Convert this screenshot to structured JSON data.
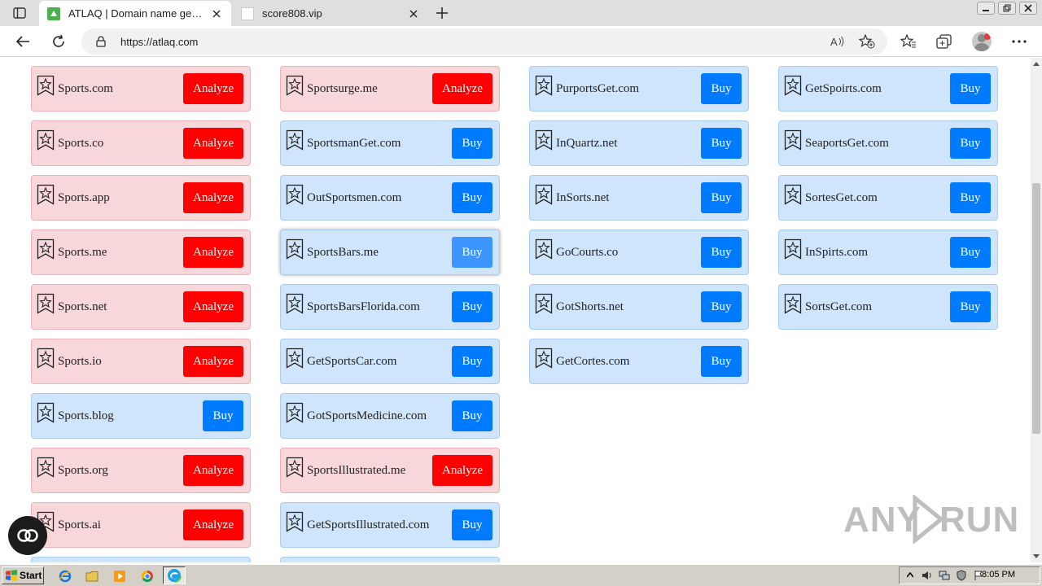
{
  "browser": {
    "tabs": [
      {
        "title": "ATLAQ | Domain name generator",
        "active": true
      },
      {
        "title": "score808.vip",
        "active": false
      }
    ],
    "url": "https://atlaq.com"
  },
  "colors": {
    "taken_bg": "#f8d7da",
    "available_bg": "#cfe5fb",
    "analyze_button": "#ff0000",
    "buy_button": "#007bff"
  },
  "labels": {
    "analyze": "Analyze",
    "buy": "Buy"
  },
  "columns": [
    [
      {
        "name": "Sports.com",
        "status": "taken"
      },
      {
        "name": "Sports.co",
        "status": "taken"
      },
      {
        "name": "Sports.app",
        "status": "taken"
      },
      {
        "name": "Sports.me",
        "status": "taken"
      },
      {
        "name": "Sports.net",
        "status": "taken"
      },
      {
        "name": "Sports.io",
        "status": "taken"
      },
      {
        "name": "Sports.blog",
        "status": "available"
      },
      {
        "name": "Sports.org",
        "status": "taken"
      },
      {
        "name": "Sports.ai",
        "status": "taken"
      }
    ],
    [
      {
        "name": "Sportsurge.me",
        "status": "taken"
      },
      {
        "name": "SportsmanGet.com",
        "status": "available"
      },
      {
        "name": "OutSportsmen.com",
        "status": "available"
      },
      {
        "name": "SportsBars.me",
        "status": "available",
        "hover": true
      },
      {
        "name": "SportsBarsFlorida.com",
        "status": "available"
      },
      {
        "name": "GetSportsCar.com",
        "status": "available"
      },
      {
        "name": "GotSportsMedicine.com",
        "status": "available"
      },
      {
        "name": "SportsIllustrated.me",
        "status": "taken"
      },
      {
        "name": "GetSportsIllustrated.com",
        "status": "available"
      }
    ],
    [
      {
        "name": "PurportsGet.com",
        "status": "available"
      },
      {
        "name": "InQuartz.net",
        "status": "available"
      },
      {
        "name": "InSorts.net",
        "status": "available"
      },
      {
        "name": "GoCourts.co",
        "status": "available"
      },
      {
        "name": "GotShorts.net",
        "status": "available"
      },
      {
        "name": "GetCortes.com",
        "status": "available"
      }
    ],
    [
      {
        "name": "GetSpoirts.com",
        "status": "available"
      },
      {
        "name": "SeaportsGet.com",
        "status": "available"
      },
      {
        "name": "SortesGet.com",
        "status": "available"
      },
      {
        "name": "InSpirts.com",
        "status": "available"
      },
      {
        "name": "SortsGet.com",
        "status": "available"
      }
    ]
  ],
  "partial_rows": [
    {
      "column": 0,
      "status": "available"
    },
    {
      "column": 1,
      "status": "available"
    }
  ],
  "watermark": {
    "left": "ANY",
    "right": "RUN"
  },
  "taskbar": {
    "start_label": "Start",
    "clock": "8:05 PM"
  }
}
